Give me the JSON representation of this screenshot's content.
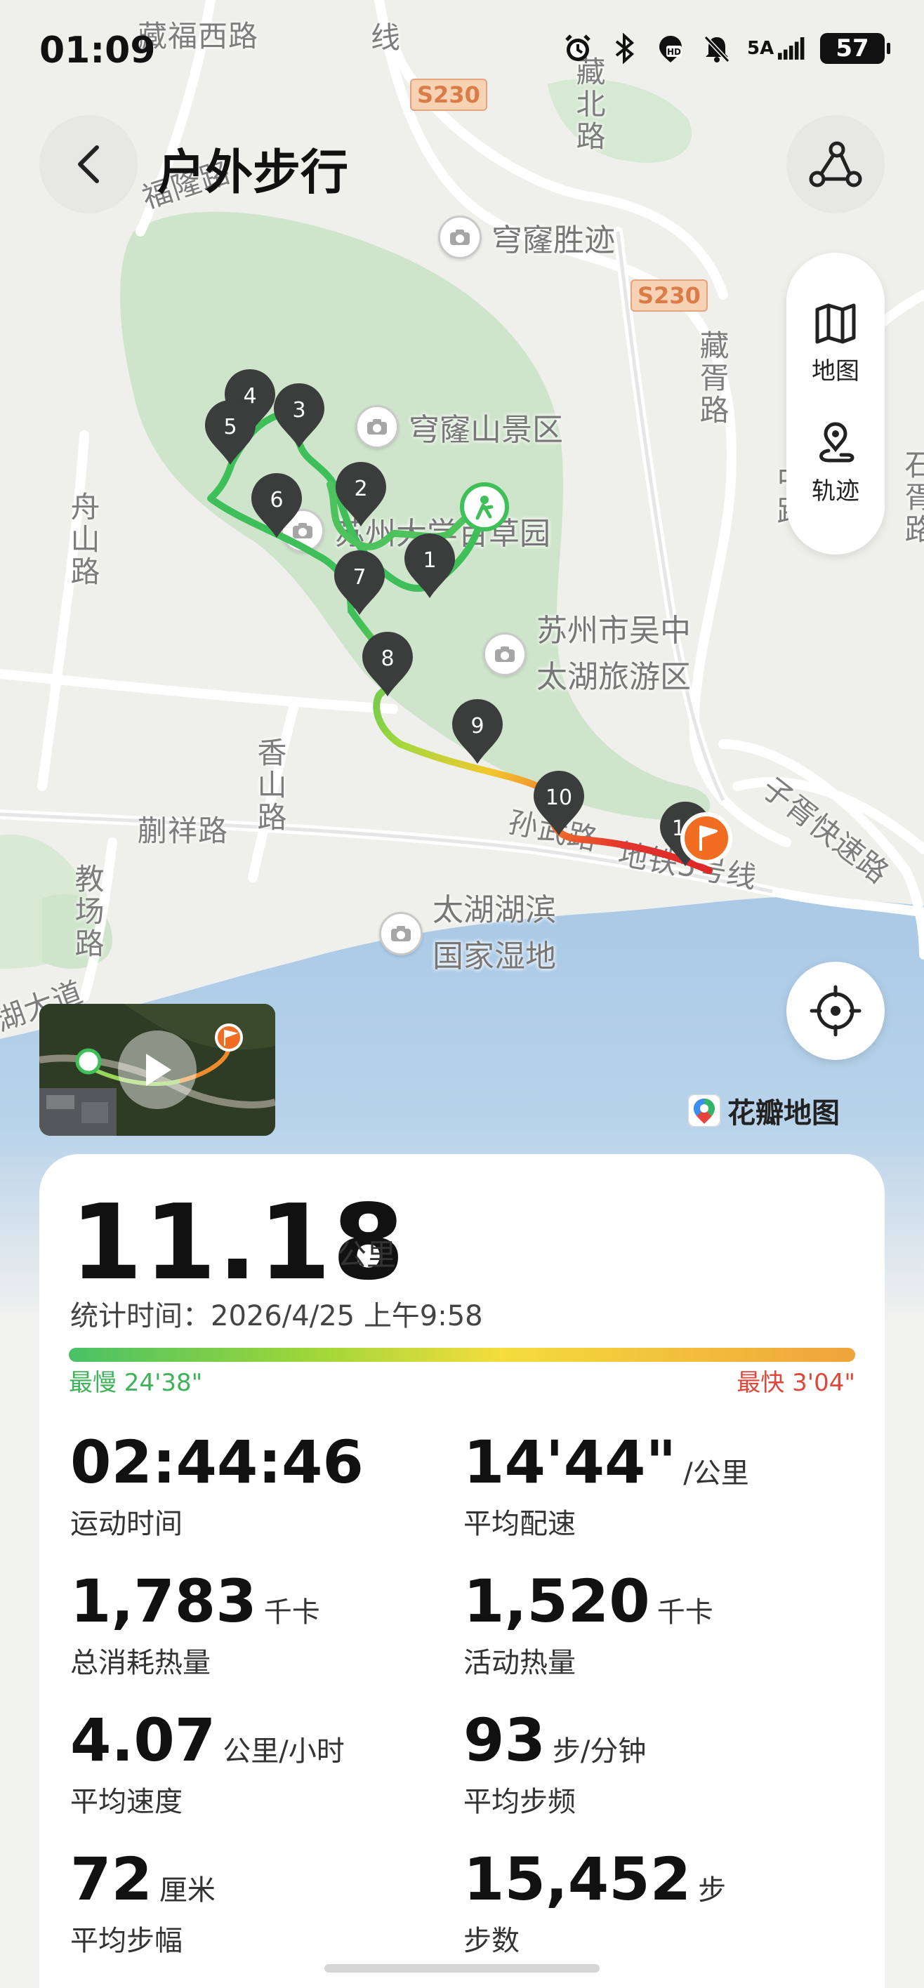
{
  "status_bar": {
    "time": "01:09",
    "network": "5A",
    "battery": "57",
    "icons": [
      "alarm-icon",
      "bluetooth-icon",
      "hd-call-icon",
      "mute-icon",
      "signal-icon",
      "battery-icon"
    ]
  },
  "header": {
    "title": "户外步行",
    "back_icon": "chevron-left-icon",
    "route_icon": "route-icon"
  },
  "map": {
    "labels": {
      "road_cangfu": "藏福西路",
      "road_fulong": "福隆路",
      "road_xian": "线",
      "road_cangbei": "藏北路",
      "road_canggui": "藏胥路",
      "road_zhou": "舟山路",
      "road_xiangshan": "香山路",
      "road_kuaixiang": "蒯祥路",
      "road_jiaochang": "教场路",
      "road_sunwu": "孙武路",
      "road_metro": "地铁5号线",
      "road_zixu": "子胥快速路",
      "road_shi": "石胥路",
      "road_zhong": "中路",
      "road_taihu": "湖大道",
      "badge_1": "S230",
      "badge_2": "S230"
    },
    "pois": {
      "qionglong_site": "穹窿胜迹",
      "qionglong_scenic": "穹窿山景区",
      "herb_garden": "苏州大学百草园",
      "wuzhong_line1": "苏州市吴中",
      "wuzhong_line2": "太湖旅游区",
      "wetland_line1": "太湖湖滨",
      "wetland_line2": "国家湿地"
    },
    "markers": [
      "1",
      "2",
      "3",
      "4",
      "5",
      "6",
      "7",
      "8",
      "9",
      "10",
      "11"
    ],
    "panel": {
      "map_label": "地图",
      "track_label": "轨迹"
    },
    "provider": "花瓣地图"
  },
  "summary": {
    "distance": "11.18",
    "distance_unit": "公里",
    "stat_time_label": "统计时间：",
    "stat_time_value": "2026/4/25 上午9:58",
    "slowest": "最慢 24'38\"",
    "fastest": "最快 3'04\""
  },
  "stats": [
    {
      "value": "02:44:46",
      "unit": "",
      "label": "运动时间"
    },
    {
      "value": "14'44\"",
      "unit": "/公里",
      "label": "平均配速"
    },
    {
      "value": "1,783",
      "unit": "千卡",
      "label": "总消耗热量"
    },
    {
      "value": "1,520",
      "unit": "千卡",
      "label": "活动热量"
    },
    {
      "value": "4.07",
      "unit": "公里/小时",
      "label": "平均速度"
    },
    {
      "value": "93",
      "unit": "步/分钟",
      "label": "平均步频"
    },
    {
      "value": "72",
      "unit": "厘米",
      "label": "平均步幅"
    },
    {
      "value": "15,452",
      "unit": "步",
      "label": "步数"
    }
  ],
  "colors": {
    "track_start": "#3fbf5a",
    "track_end": "#e02a2a",
    "water": "#a9c9e6",
    "park": "#cfe6cb"
  }
}
